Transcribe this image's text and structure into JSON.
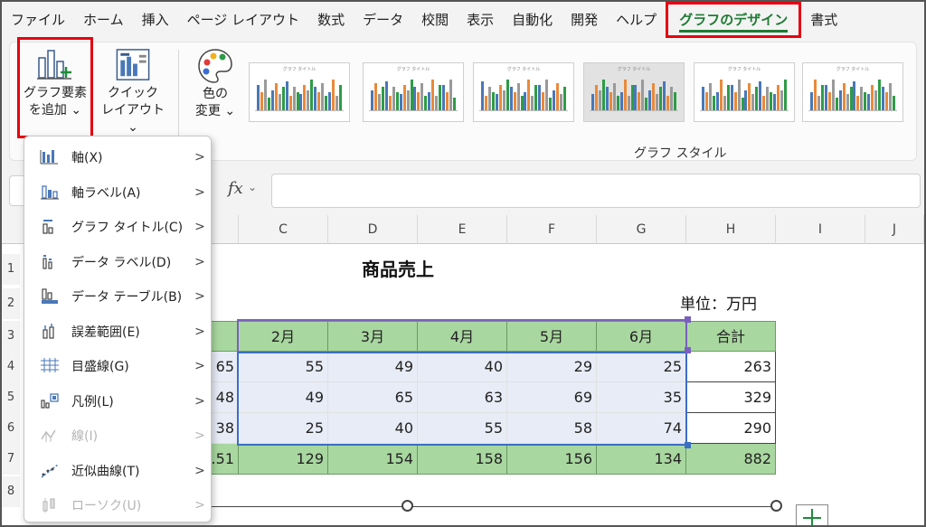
{
  "menu": {
    "tabs": [
      "ファイル",
      "ホーム",
      "挿入",
      "ページ レイアウト",
      "数式",
      "データ",
      "校閲",
      "表示",
      "自動化",
      "開発",
      "ヘルプ"
    ],
    "active": "グラフのデザイン",
    "after": "書式"
  },
  "ribbon": {
    "add_element_line1": "グラフ要素",
    "add_element_line2": "を追加 ⌄",
    "quick_layout_line1": "クイック",
    "quick_layout_line2": "レイアウト ⌄",
    "color_line1": "色の",
    "color_line2": "変更 ⌄",
    "styles_label": "グラフ スタイル",
    "thumb_title": "グラフ タイトル"
  },
  "formula": {
    "fx": "fx",
    "chevron": "⌄"
  },
  "columns": [
    "C",
    "D",
    "E",
    "F",
    "G",
    "H",
    "I",
    "J"
  ],
  "rows": [
    "1",
    "2",
    "3",
    "4",
    "5",
    "6",
    "7",
    "8"
  ],
  "sheet": {
    "title": "商品売上",
    "unit": "単位：万円",
    "headers": [
      "2月",
      "3月",
      "4月",
      "5月",
      "6月",
      "合計"
    ],
    "data": [
      {
        "b": "65",
        "vals": [
          "55",
          "49",
          "40",
          "29",
          "25"
        ],
        "total": "263"
      },
      {
        "b": "48",
        "vals": [
          "49",
          "65",
          "63",
          "69",
          "35"
        ],
        "total": "329"
      },
      {
        "b": "38",
        "vals": [
          "25",
          "40",
          "55",
          "58",
          "74"
        ],
        "total": "290"
      }
    ],
    "totals": {
      "b": ".51",
      "vals": [
        "129",
        "154",
        "158",
        "156",
        "134"
      ],
      "total": "882"
    }
  },
  "dropdown": {
    "items": [
      {
        "label": "軸(X)",
        "icon": "axis-icon",
        "enabled": true
      },
      {
        "label": "軸ラベル(A)",
        "icon": "axis-label-icon",
        "enabled": true
      },
      {
        "label": "グラフ タイトル(C)",
        "icon": "chart-title-icon",
        "enabled": true
      },
      {
        "label": "データ ラベル(D)",
        "icon": "data-label-icon",
        "enabled": true
      },
      {
        "label": "データ テーブル(B)",
        "icon": "data-table-icon",
        "enabled": true
      },
      {
        "label": "誤差範囲(E)",
        "icon": "error-bars-icon",
        "enabled": true
      },
      {
        "label": "目盛線(G)",
        "icon": "gridlines-icon",
        "enabled": true
      },
      {
        "label": "凡例(L)",
        "icon": "legend-icon",
        "enabled": true
      },
      {
        "label": "線(I)",
        "icon": "lines-icon",
        "enabled": false
      },
      {
        "label": "近似曲線(T)",
        "icon": "trendline-icon",
        "enabled": true
      },
      {
        "label": "ローソク(U)",
        "icon": "up-down-bars-icon",
        "enabled": false
      }
    ],
    "arrow": ">"
  },
  "colors": {
    "highlight": "#e60012",
    "active_tab": "#1e7b34",
    "header_fill": "#a9d7a0",
    "data_fill": "#e8ecf7"
  }
}
